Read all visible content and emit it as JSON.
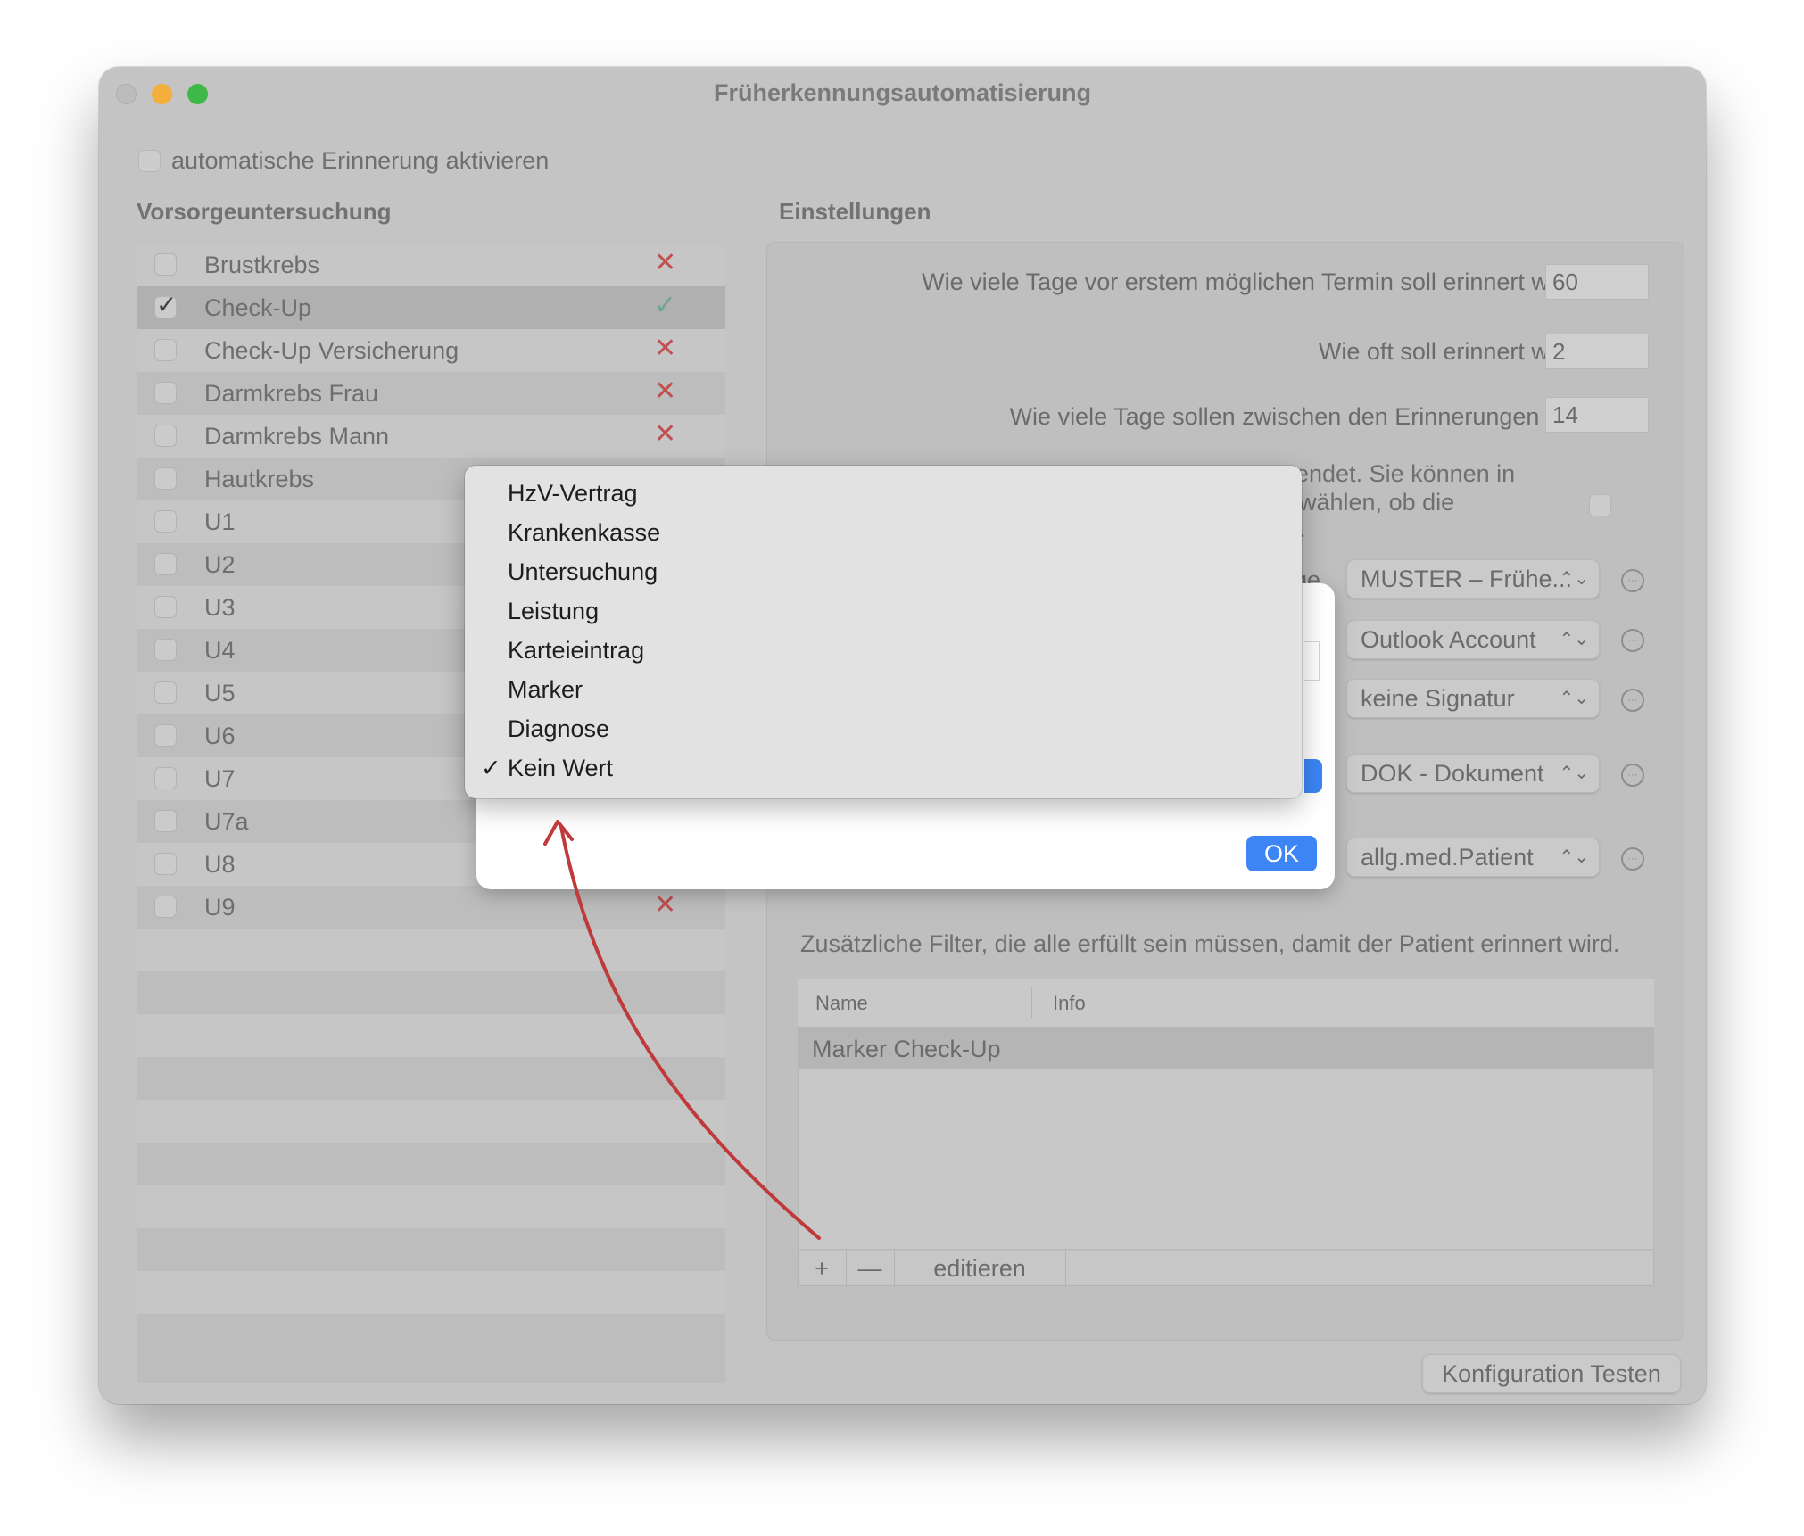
{
  "window": {
    "title": "Früherkennungsautomatisierung"
  },
  "auto_reminder": {
    "label": "automatische Erinnerung aktivieren"
  },
  "left": {
    "heading": "Vorsorgeuntersuchung",
    "items": [
      {
        "label": "Brustkrebs",
        "checked": false,
        "status": "✕"
      },
      {
        "label": "Check-Up",
        "checked": true,
        "status": "✓"
      },
      {
        "label": "Check-Up Versicherung",
        "checked": false,
        "status": "✕"
      },
      {
        "label": "Darmkrebs Frau",
        "checked": false,
        "status": "✕"
      },
      {
        "label": "Darmkrebs Mann",
        "checked": false,
        "status": "✕"
      },
      {
        "label": "Hautkrebs",
        "checked": false,
        "status": ""
      },
      {
        "label": "U1",
        "checked": false,
        "status": ""
      },
      {
        "label": "U2",
        "checked": false,
        "status": ""
      },
      {
        "label": "U3",
        "checked": false,
        "status": ""
      },
      {
        "label": "U4",
        "checked": false,
        "status": ""
      },
      {
        "label": "U5",
        "checked": false,
        "status": ""
      },
      {
        "label": "U6",
        "checked": false,
        "status": ""
      },
      {
        "label": "U7",
        "checked": false,
        "status": ""
      },
      {
        "label": "U7a",
        "checked": false,
        "status": ""
      },
      {
        "label": "U8",
        "checked": false,
        "status": ""
      },
      {
        "label": "U9",
        "checked": false,
        "status": "✕"
      }
    ]
  },
  "settings": {
    "heading": "Einstellungen",
    "q1": {
      "label": "Wie viele Tage vor erstem möglichen Termin soll erinnert werden?",
      "value": "60"
    },
    "q2": {
      "label": "Wie oft soll erinnert werden?",
      "value": "2"
    },
    "q3": {
      "label": "Wie viele Tage sollen zwischen den Erinnerungen liegen?",
      "value": "14"
    },
    "partial": {
      "line1": "endet. Sie können in",
      "line2": "wählen, ob die",
      "line3": ".",
      "label_tail": "ge"
    },
    "popups": {
      "template": "MUSTER – Frühe...",
      "account": "Outlook Account",
      "signature": "keine Signatur",
      "document": "DOK - Dokument",
      "patient": "allg.med.Patient"
    },
    "filters_text": "Zusätzliche Filter, die alle erfüllt sein müssen, damit der Patient erinnert wird.",
    "table": {
      "columns": [
        "Name",
        "Info"
      ],
      "rows": [
        {
          "name": "Marker Check-Up",
          "info": ""
        }
      ]
    },
    "buttons": {
      "add": "+",
      "remove": "—",
      "edit": "editieren"
    },
    "test_button": "Konfiguration Testen"
  },
  "sheet": {
    "ok": "OK"
  },
  "menu": {
    "items": [
      "HzV-Vertrag",
      "Krankenkasse",
      "Untersuchung",
      "Leistung",
      "Karteieintrag",
      "Marker",
      "Diagnose",
      "Kein Wert"
    ],
    "selected": "Kein Wert",
    "check_glyph": "✓"
  },
  "icons": {
    "updown": "⌃⌄",
    "more": "···"
  },
  "colors": {
    "accent": "#3d85f5",
    "annotation_arrow": "#c0393b"
  }
}
